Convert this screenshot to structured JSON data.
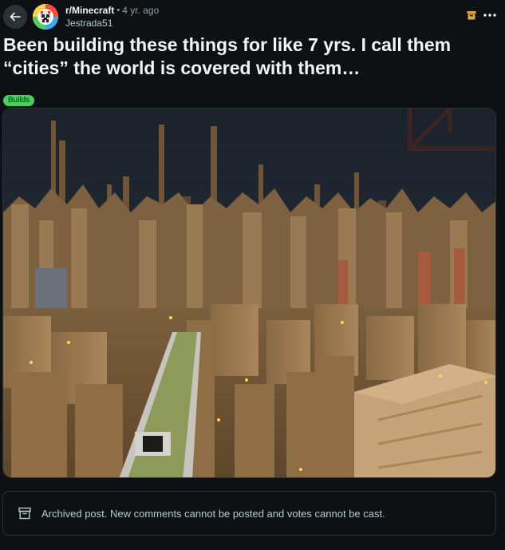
{
  "header": {
    "subreddit": "r/Minecraft",
    "separator": "•",
    "age": "4 yr. ago",
    "author": "Jestrada51"
  },
  "post": {
    "title": "Been building these things for like 7 yrs. I call them “cities” the world is covered with them…",
    "flair": "Builds"
  },
  "archived_notice": {
    "text": "Archived post. New comments cannot be posted and votes cannot be cast."
  },
  "icons": {
    "back": "arrow-left-icon",
    "archive": "archive-box-icon",
    "more": "ellipsis-icon",
    "avatar": "subreddit-avatar"
  },
  "colors": {
    "background": "#0e1113",
    "flair_bg": "#46d160",
    "text_primary": "#f2f4f5",
    "text_secondary": "#8ba2ad",
    "archive_icon_accent": "#d7a84a"
  }
}
